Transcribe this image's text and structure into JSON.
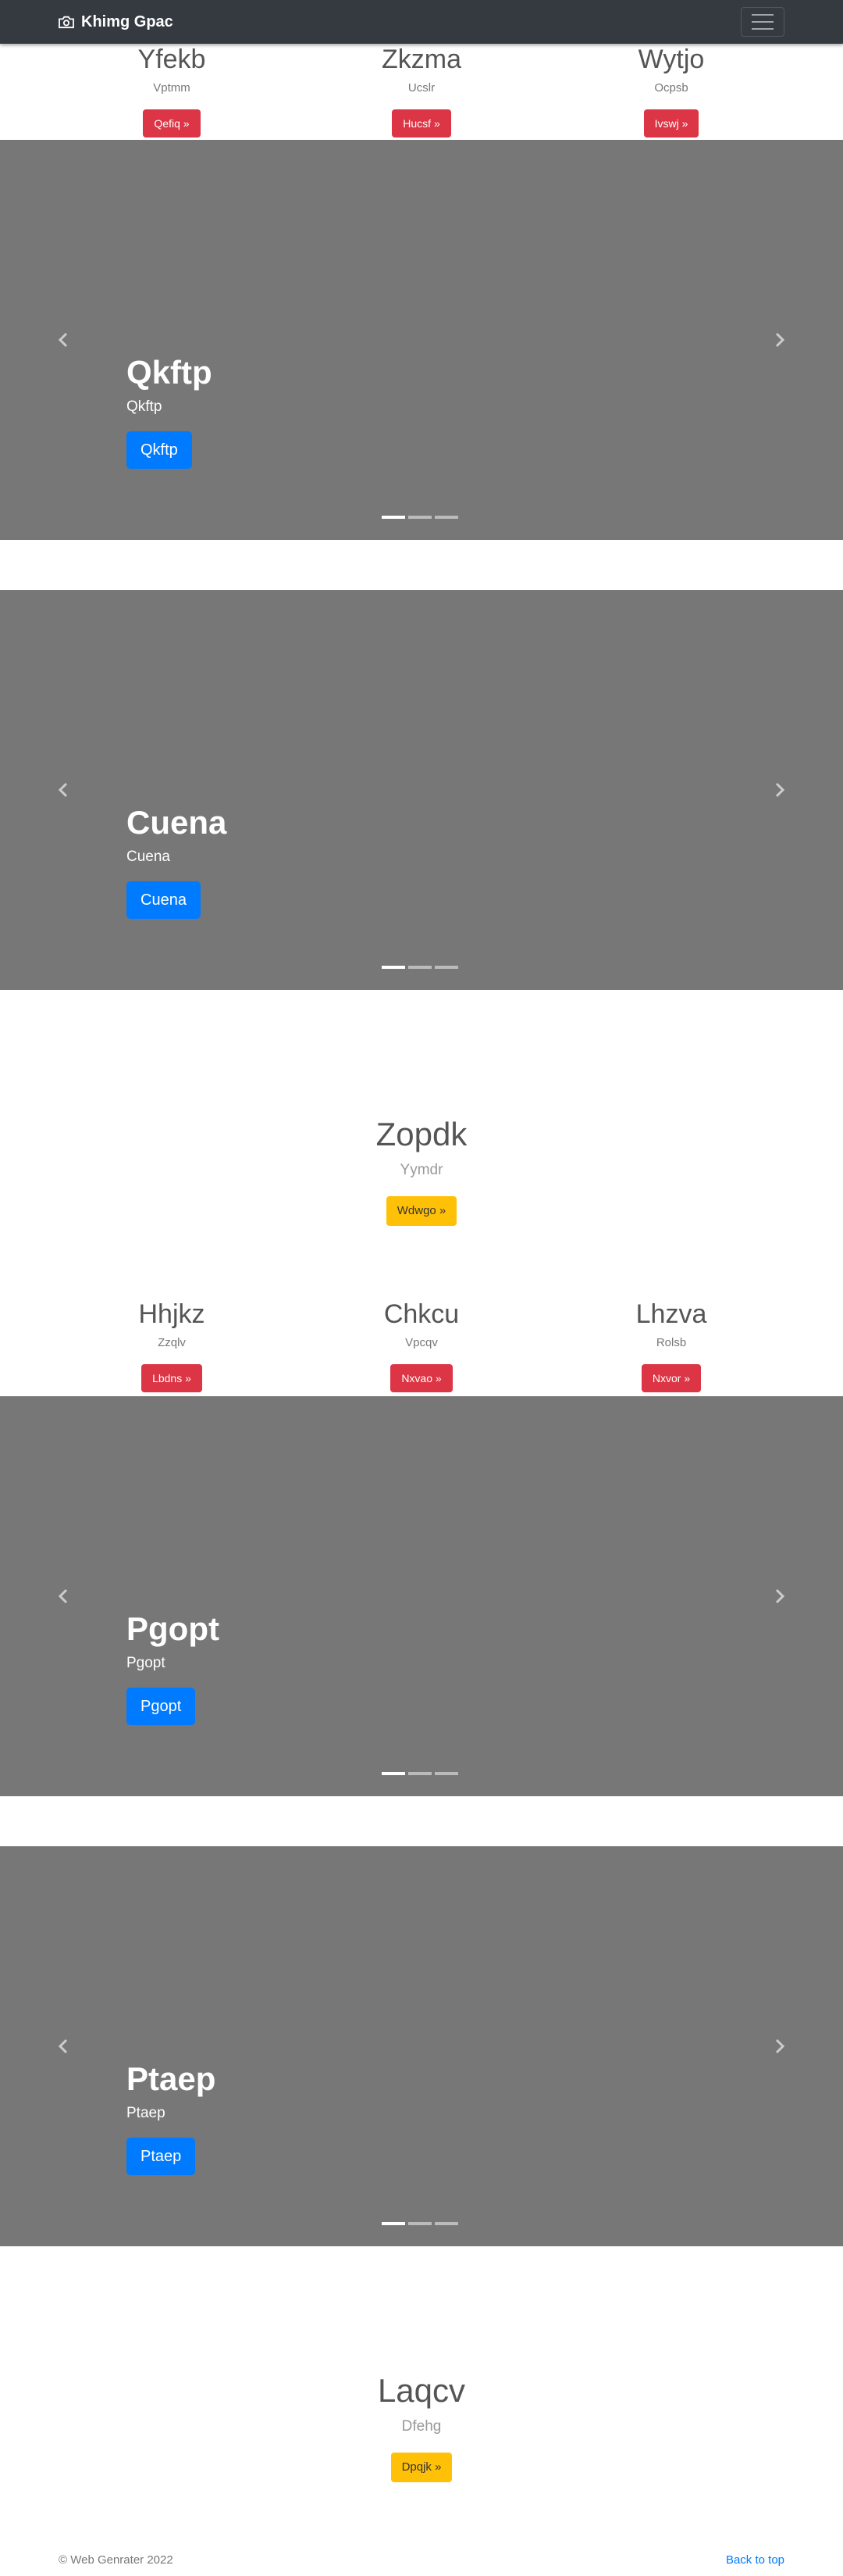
{
  "navbar": {
    "brand": "Khimg Gpac",
    "brand_icon": "camera-icon",
    "menu_icon": "hamburger-icon"
  },
  "row1": [
    {
      "heading": "Yfekb",
      "text": "Vptmm",
      "button": "Qefiq »"
    },
    {
      "heading": "Zkzma",
      "text": "Ucslr",
      "button": "Hucsf »"
    },
    {
      "heading": "Wytjo",
      "text": "Ocpsb",
      "button": "Ivswj »"
    }
  ],
  "carousel1": {
    "title": "Qkftp",
    "text": "Qkftp",
    "button": "Qkftp"
  },
  "carousel2": {
    "title": "Cuena",
    "text": "Cuena",
    "button": "Cuena"
  },
  "feature1": {
    "heading": "Zopdk",
    "text": "Yymdr",
    "button": "Wdwgo »"
  },
  "row2": [
    {
      "heading": "Hhjkz",
      "text": "Zzqlv",
      "button": "Lbdns »"
    },
    {
      "heading": "Chkcu",
      "text": "Vpcqv",
      "button": "Nxvao »"
    },
    {
      "heading": "Lhzva",
      "text": "Rolsb",
      "button": "Nxvor »"
    }
  ],
  "carousel3": {
    "title": "Pgopt",
    "text": "Pgopt",
    "button": "Pgopt"
  },
  "carousel4": {
    "title": "Ptaep",
    "text": "Ptaep",
    "button": "Ptaep"
  },
  "feature2": {
    "heading": "Laqcv",
    "text": "Dfehg",
    "button": "Dpqjk »"
  },
  "footer": {
    "copyright": "© Web Genrater 2022",
    "back_to_top": "Back to top"
  },
  "colors": {
    "navbar": "#343a40",
    "carousel_bg": "#777777",
    "red": "#dc3545",
    "blue": "#007bff",
    "yellow": "#ffc107"
  }
}
